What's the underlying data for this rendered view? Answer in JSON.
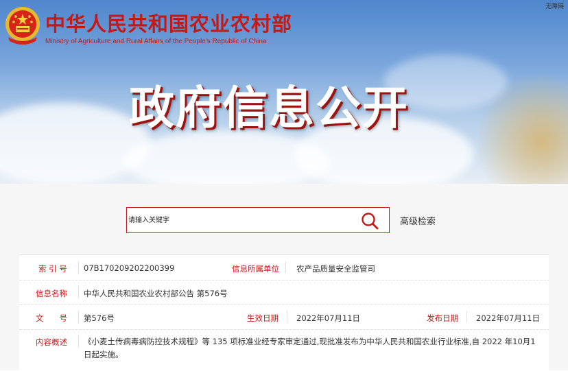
{
  "header": {
    "ministry_name_cn": "中华人民共和国农业农村部",
    "ministry_name_en": "Ministry of Agriculture and Rural Affairs of the People's Republic of China",
    "accessible_link": "无障碍",
    "page_heading": "政府信息公开",
    "emblem_icon": "national-emblem-icon"
  },
  "search": {
    "placeholder": "请输入关键字",
    "search_icon": "search-icon",
    "advanced_label": "高级检索"
  },
  "colors": {
    "accent": "#c41a17",
    "label_red": "#c41a17"
  },
  "info": {
    "index_no_label": "索 引 号",
    "index_no_value": "07B170209202200399",
    "org_label": "信息所属单位",
    "org_value": "农产品质量安全监管司",
    "name_label": "信息名称",
    "name_value": "中华人民共和国农业农村部公告 第576号",
    "doc_no_label": "文　　号",
    "doc_no_value": "第576号",
    "effective_date_label": "生效日期",
    "effective_date_value": "2022年07月11日",
    "publish_date_label": "发布日期",
    "publish_date_value": "2022年07月11日",
    "summary_label": "内容概述",
    "summary_value": "《小麦土传病毒病防控技术规程》等 135 项标准业经专家审定通过,现批准发布为中华人民共和国农业行业标准,自 2022 年10月1日起实施。"
  }
}
